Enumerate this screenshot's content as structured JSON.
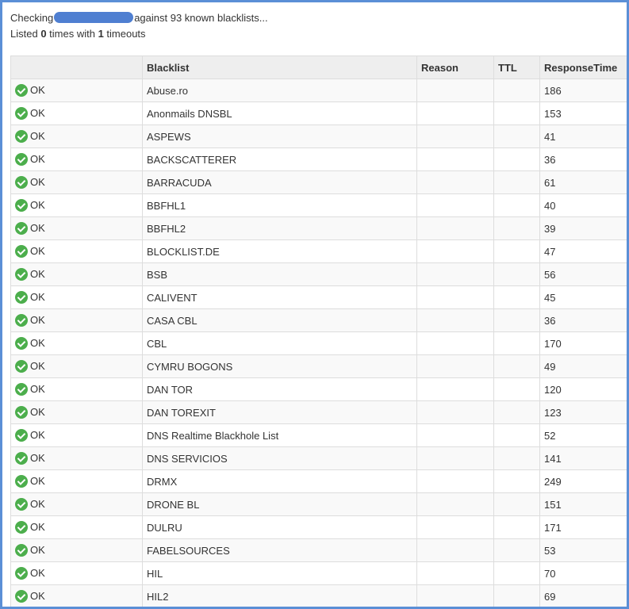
{
  "summary": {
    "checking": "Checking",
    "against": "against 93 known blacklists...",
    "listed_prefix": "Listed ",
    "listed_count": "0",
    "times_with": " times with ",
    "timeouts_count": "1",
    "timeouts_suffix": " timeouts"
  },
  "table": {
    "headers": [
      "",
      "Blacklist",
      "Reason",
      "TTL",
      "ResponseTime"
    ],
    "rows": [
      {
        "status": "OK",
        "blacklist": "Abuse.ro",
        "reason": "",
        "ttl": "",
        "response": "186"
      },
      {
        "status": "OK",
        "blacklist": "Anonmails DNSBL",
        "reason": "",
        "ttl": "",
        "response": "153"
      },
      {
        "status": "OK",
        "blacklist": "ASPEWS",
        "reason": "",
        "ttl": "",
        "response": "41"
      },
      {
        "status": "OK",
        "blacklist": "BACKSCATTERER",
        "reason": "",
        "ttl": "",
        "response": "36"
      },
      {
        "status": "OK",
        "blacklist": "BARRACUDA",
        "reason": "",
        "ttl": "",
        "response": "61"
      },
      {
        "status": "OK",
        "blacklist": "BBFHL1",
        "reason": "",
        "ttl": "",
        "response": "40"
      },
      {
        "status": "OK",
        "blacklist": "BBFHL2",
        "reason": "",
        "ttl": "",
        "response": "39"
      },
      {
        "status": "OK",
        "blacklist": "BLOCKLIST.DE",
        "reason": "",
        "ttl": "",
        "response": "47"
      },
      {
        "status": "OK",
        "blacklist": "BSB",
        "reason": "",
        "ttl": "",
        "response": "56"
      },
      {
        "status": "OK",
        "blacklist": "CALIVENT",
        "reason": "",
        "ttl": "",
        "response": "45"
      },
      {
        "status": "OK",
        "blacklist": "CASA CBL",
        "reason": "",
        "ttl": "",
        "response": "36"
      },
      {
        "status": "OK",
        "blacklist": "CBL",
        "reason": "",
        "ttl": "",
        "response": "170"
      },
      {
        "status": "OK",
        "blacklist": "CYMRU BOGONS",
        "reason": "",
        "ttl": "",
        "response": "49"
      },
      {
        "status": "OK",
        "blacklist": "DAN TOR",
        "reason": "",
        "ttl": "",
        "response": "120"
      },
      {
        "status": "OK",
        "blacklist": "DAN TOREXIT",
        "reason": "",
        "ttl": "",
        "response": "123"
      },
      {
        "status": "OK",
        "blacklist": "DNS Realtime Blackhole List",
        "reason": "",
        "ttl": "",
        "response": "52"
      },
      {
        "status": "OK",
        "blacklist": "DNS SERVICIOS",
        "reason": "",
        "ttl": "",
        "response": "141"
      },
      {
        "status": "OK",
        "blacklist": "DRMX",
        "reason": "",
        "ttl": "",
        "response": "249"
      },
      {
        "status": "OK",
        "blacklist": "DRONE BL",
        "reason": "",
        "ttl": "",
        "response": "151"
      },
      {
        "status": "OK",
        "blacklist": "DULRU",
        "reason": "",
        "ttl": "",
        "response": "171"
      },
      {
        "status": "OK",
        "blacklist": "FABELSOURCES",
        "reason": "",
        "ttl": "",
        "response": "53"
      },
      {
        "status": "OK",
        "blacklist": "HIL",
        "reason": "",
        "ttl": "",
        "response": "70"
      },
      {
        "status": "OK",
        "blacklist": "HIL2",
        "reason": "",
        "ttl": "",
        "response": "69"
      }
    ]
  },
  "colors": {
    "ok": "#4cae4c",
    "border": "#5b8fd6",
    "redaction": "#4f7fd1"
  },
  "icons": {
    "status_ok": "check-circle-icon"
  }
}
